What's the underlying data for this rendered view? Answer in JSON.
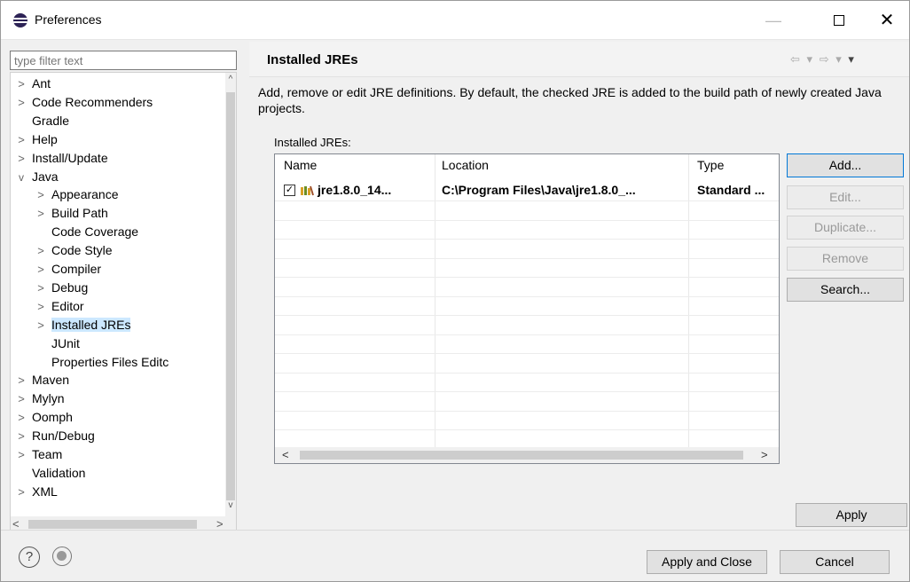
{
  "window": {
    "title": "Preferences",
    "minimize_glyph": "—",
    "close_glyph": "✕"
  },
  "filter": {
    "placeholder": "type filter text"
  },
  "tree": {
    "items": [
      {
        "label": "Ant",
        "twisty": ">"
      },
      {
        "label": "Code Recommenders",
        "twisty": ">"
      },
      {
        "label": "Gradle",
        "twisty": ""
      },
      {
        "label": "Help",
        "twisty": ">"
      },
      {
        "label": "Install/Update",
        "twisty": ">"
      },
      {
        "label": "Java",
        "twisty": "v"
      },
      {
        "label": "Appearance",
        "twisty": ">"
      },
      {
        "label": "Build Path",
        "twisty": ">"
      },
      {
        "label": "Code Coverage",
        "twisty": ""
      },
      {
        "label": "Code Style",
        "twisty": ">"
      },
      {
        "label": "Compiler",
        "twisty": ">"
      },
      {
        "label": "Debug",
        "twisty": ">"
      },
      {
        "label": "Editor",
        "twisty": ">"
      },
      {
        "label": "Installed JREs",
        "twisty": ">",
        "selected": true
      },
      {
        "label": "JUnit",
        "twisty": ""
      },
      {
        "label": "Properties Files Editc",
        "twisty": ""
      },
      {
        "label": "Maven",
        "twisty": ">"
      },
      {
        "label": "Mylyn",
        "twisty": ">"
      },
      {
        "label": "Oomph",
        "twisty": ">"
      },
      {
        "label": "Run/Debug",
        "twisty": ">"
      },
      {
        "label": "Team",
        "twisty": ">"
      },
      {
        "label": "Validation",
        "twisty": ""
      },
      {
        "label": "XML",
        "twisty": ">"
      }
    ],
    "scroll_up": "^",
    "scroll_down": "v",
    "scroll_left": "<",
    "scroll_right": ">"
  },
  "page": {
    "title": "Installed JREs",
    "nav_back": "⇦",
    "nav_forward": "⇨",
    "nav_menu": "▾",
    "description": "Add, remove or edit JRE definitions. By default, the checked JRE is added to the build path of newly created Java projects.",
    "list_label": "Installed JREs:"
  },
  "table": {
    "columns": [
      "Name",
      "Location",
      "Type"
    ],
    "rows": [
      {
        "checked": true,
        "check_glyph": "✓",
        "name": "jre1.8.0_14...",
        "location": "C:\\Program Files\\Java\\jre1.8.0_...",
        "type": "Standard ..."
      }
    ],
    "scroll_left": "<",
    "scroll_right": ">"
  },
  "buttons": {
    "add": "Add...",
    "edit": "Edit...",
    "duplicate": "Duplicate...",
    "remove": "Remove",
    "search": "Search...",
    "apply": "Apply",
    "apply_and_close": "Apply and Close",
    "cancel": "Cancel"
  },
  "footer": {
    "help_glyph": "?"
  },
  "colors": {
    "selection": "#cce8ff",
    "default_button_border": "#0078d7",
    "disabled_text": "#999999"
  }
}
